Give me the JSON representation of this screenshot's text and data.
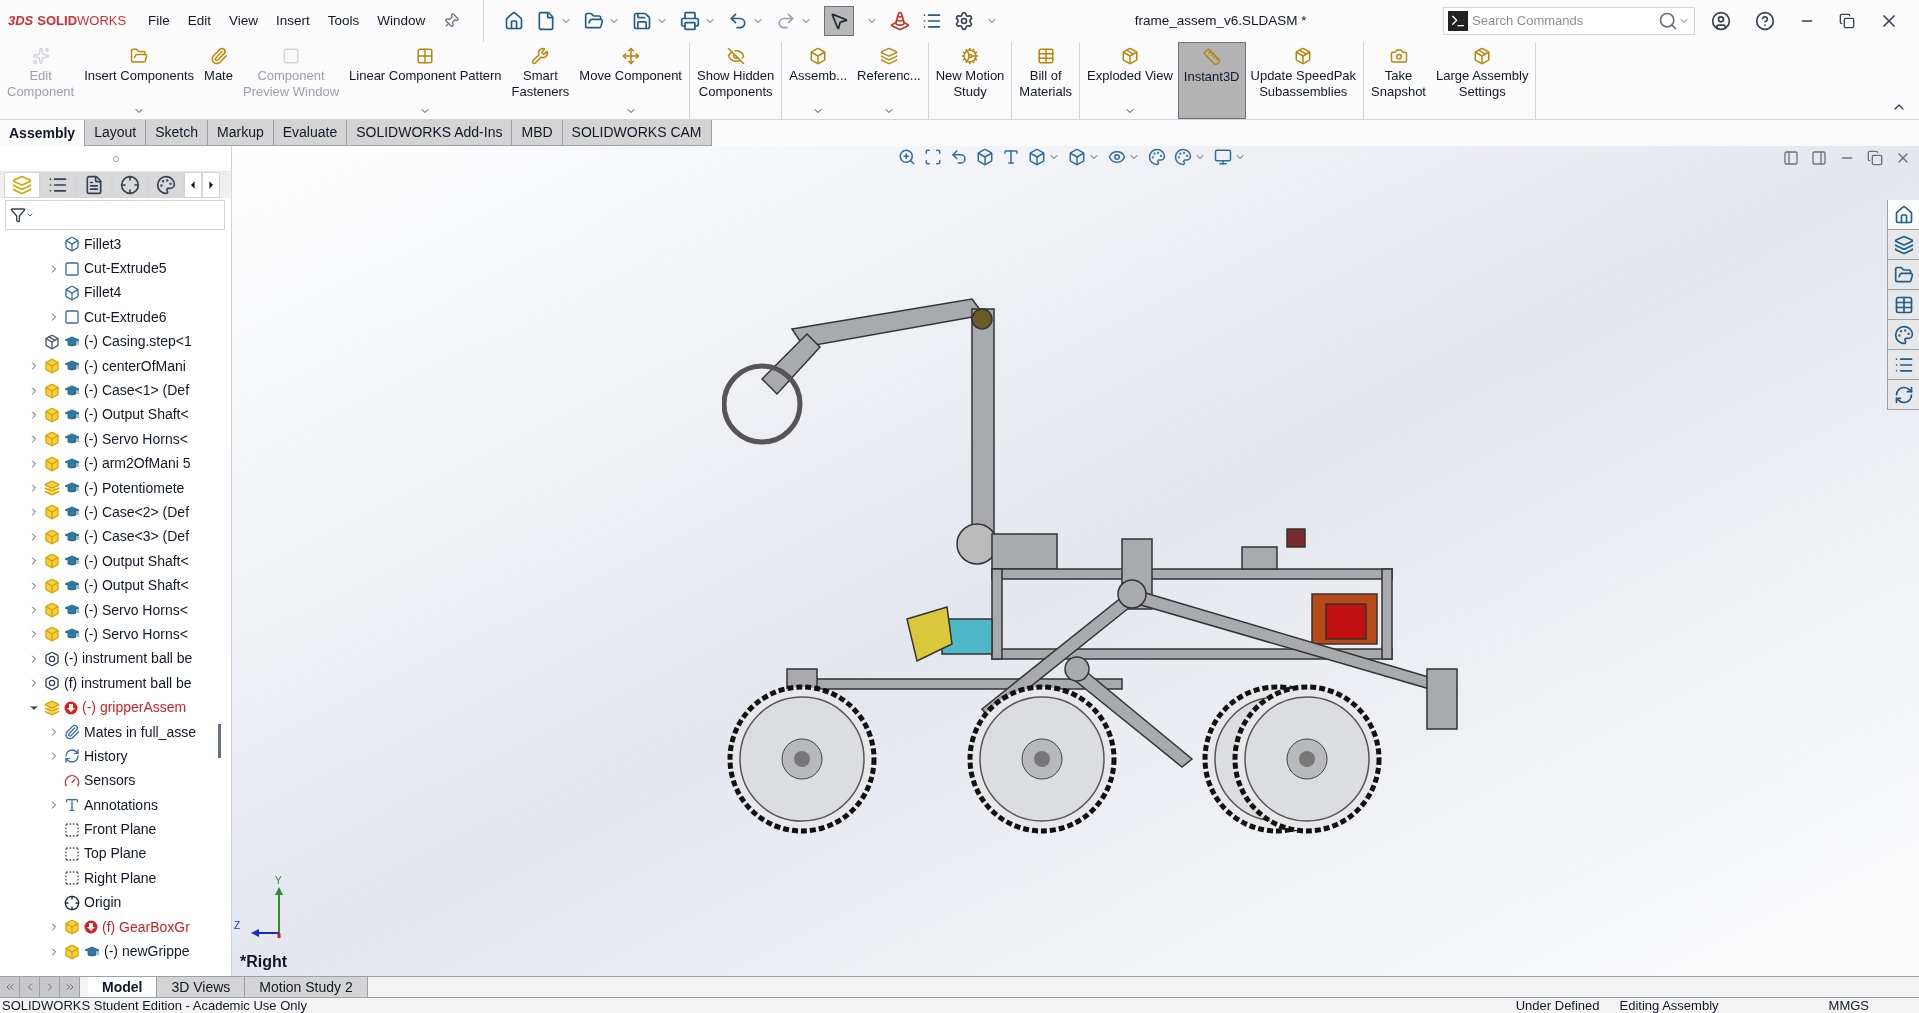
{
  "app": {
    "logo_prefix": "3DS",
    "logo_bold": "SOLID",
    "logo_rest": "WORKS"
  },
  "menu": [
    "File",
    "Edit",
    "View",
    "Insert",
    "Tools",
    "Window"
  ],
  "window": {
    "title": "frame_assem_v6.SLDASM *"
  },
  "search": {
    "placeholder": "Search Commands"
  },
  "ribbon": {
    "groups": [
      [
        {
          "label": "Edit\nComponent",
          "disabled": true,
          "dropdown": false,
          "selected": false
        },
        {
          "label": "Insert Components",
          "disabled": false,
          "dropdown": true,
          "selected": false
        },
        {
          "label": "Mate",
          "disabled": false,
          "dropdown": false,
          "selected": false
        },
        {
          "label": "Component\nPreview Window",
          "disabled": true,
          "dropdown": false,
          "selected": false
        },
        {
          "label": "Linear Component Pattern",
          "disabled": false,
          "dropdown": true,
          "selected": false
        },
        {
          "label": "Smart\nFasteners",
          "disabled": false,
          "dropdown": false,
          "selected": false
        },
        {
          "label": "Move Component",
          "disabled": false,
          "dropdown": true,
          "selected": false
        }
      ],
      [
        {
          "label": "Show Hidden\nComponents",
          "disabled": false,
          "dropdown": false,
          "selected": false
        }
      ],
      [
        {
          "label": "Assemb...",
          "disabled": false,
          "dropdown": true,
          "selected": false
        },
        {
          "label": "Referenc...",
          "disabled": false,
          "dropdown": true,
          "selected": false
        }
      ],
      [
        {
          "label": "New Motion\nStudy",
          "disabled": false,
          "dropdown": false,
          "selected": false
        }
      ],
      [
        {
          "label": "Bill of\nMaterials",
          "disabled": false,
          "dropdown": false,
          "selected": false
        }
      ],
      [
        {
          "label": "Exploded View",
          "disabled": false,
          "dropdown": true,
          "selected": false
        },
        {
          "label": "Instant3D",
          "disabled": false,
          "dropdown": false,
          "selected": true
        },
        {
          "label": "Update SpeedPak\nSubassemblies",
          "disabled": false,
          "dropdown": false,
          "selected": false
        }
      ],
      [
        {
          "label": "Take\nSnapshot",
          "disabled": false,
          "dropdown": false,
          "selected": false
        },
        {
          "label": "Large Assembly\nSettings",
          "disabled": false,
          "dropdown": false,
          "selected": false
        }
      ]
    ]
  },
  "tabs": [
    {
      "label": "Assembly",
      "selected": true
    },
    {
      "label": "Layout",
      "selected": false
    },
    {
      "label": "Sketch",
      "selected": false
    },
    {
      "label": "Markup",
      "selected": false
    },
    {
      "label": "Evaluate",
      "selected": false
    },
    {
      "label": "SOLIDWORKS Add-Ins",
      "selected": false
    },
    {
      "label": "MBD",
      "selected": false
    },
    {
      "label": "SOLIDWORKS CAM",
      "selected": false
    }
  ],
  "tree": {
    "items": [
      {
        "children": [
          {
            "label": "Fillet3",
            "kind": "feature"
          },
          {
            "label": "Cut-Extrude5",
            "kind": "cut",
            "expanded": false
          },
          {
            "label": "Fillet4",
            "kind": "feature"
          },
          {
            "label": "Cut-Extrude6",
            "kind": "cut",
            "expanded": false
          }
        ]
      },
      {
        "label": "(-) Casing.step<1",
        "kind": "imported",
        "cap": true,
        "error": false
      },
      {
        "label": "(-) centerOfMani",
        "kind": "part",
        "cap": true,
        "error": false,
        "expanded": false
      },
      {
        "label": "(-) Case<1> (Def",
        "kind": "part",
        "cap": true,
        "error": false,
        "expanded": false
      },
      {
        "label": "(-) Output Shaft<",
        "kind": "part",
        "cap": true,
        "error": false,
        "expanded": false
      },
      {
        "label": "(-) Servo Horns<",
        "kind": "part",
        "cap": true,
        "error": false,
        "expanded": false
      },
      {
        "label": "(-) arm2OfMani 5",
        "kind": "part",
        "cap": true,
        "error": false,
        "expanded": false
      },
      {
        "label": "(-) Potentiomete",
        "kind": "assembly",
        "cap": true,
        "error": false,
        "expanded": false
      },
      {
        "label": "(-) Case<2> (Def",
        "kind": "part",
        "cap": true,
        "error": false,
        "expanded": false
      },
      {
        "label": "(-) Case<3> (Def",
        "kind": "part",
        "cap": true,
        "error": false,
        "expanded": false
      },
      {
        "label": "(-) Output Shaft<",
        "kind": "part",
        "cap": true,
        "error": false,
        "expanded": false
      },
      {
        "label": "(-) Output Shaft<",
        "kind": "part",
        "cap": true,
        "error": false,
        "expanded": false
      },
      {
        "label": "(-) Servo Horns<",
        "kind": "part",
        "cap": true,
        "error": false,
        "expanded": false
      },
      {
        "label": "(-) Servo Horns<",
        "kind": "part",
        "cap": true,
        "error": false,
        "expanded": false
      },
      {
        "label": "(-) instrument ball be",
        "kind": "bolt",
        "cap": false,
        "error": false,
        "expanded": false
      },
      {
        "label": "(f) instrument ball be",
        "kind": "bolt",
        "cap": false,
        "error": false,
        "expanded": false
      },
      {
        "label": "(-) gripperAssem",
        "kind": "assembly",
        "cap": false,
        "error": true,
        "expanded": true,
        "children": [
          {
            "label": "Mates in full_asse",
            "kind": "mates",
            "cap": false,
            "error": false,
            "expanded": false
          },
          {
            "label": "History",
            "kind": "history",
            "cap": false,
            "error": false,
            "expanded": false
          },
          {
            "label": "Sensors",
            "kind": "sensors",
            "cap": false,
            "error": false
          },
          {
            "label": "Annotations",
            "kind": "annotations",
            "cap": false,
            "error": false,
            "expanded": false
          },
          {
            "label": "Front Plane",
            "kind": "plane",
            "cap": false,
            "error": false
          },
          {
            "label": "Top Plane",
            "kind": "plane",
            "cap": false,
            "error": false
          },
          {
            "label": "Right Plane",
            "kind": "plane",
            "cap": false,
            "error": false
          },
          {
            "label": "Origin",
            "kind": "origin",
            "cap": false,
            "error": false
          },
          {
            "label": "(f) GearBoxGr",
            "kind": "part",
            "cap": false,
            "error": true,
            "expanded": false
          },
          {
            "label": "(-) newGrippe",
            "kind": "part",
            "cap": true,
            "error": false,
            "expanded": false
          }
        ]
      }
    ]
  },
  "viewport": {
    "view_name": "*Right",
    "triad": {
      "y": "Y",
      "z": "Z"
    }
  },
  "bottom_tabs": [
    {
      "label": "Model",
      "selected": true
    },
    {
      "label": "3D Views",
      "selected": false
    },
    {
      "label": "Motion Study 2",
      "selected": false
    }
  ],
  "status_bar": {
    "edition": "SOLIDWORKS Student Edition - Academic Use Only",
    "state": "Under Defined",
    "mode": "Editing Assembly",
    "units": "MMGS"
  }
}
